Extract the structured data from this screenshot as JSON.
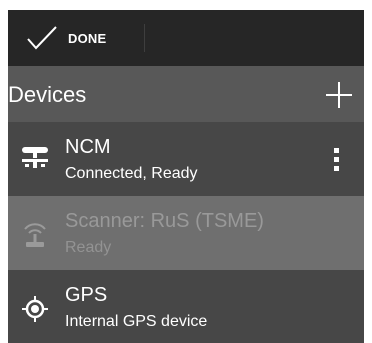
{
  "toolbar": {
    "done_label": "DONE",
    "done_icon": "check-icon"
  },
  "header": {
    "title": "Devices",
    "add_icon": "plus-icon"
  },
  "devices": [
    {
      "name": "NCM",
      "status": "Connected, Ready",
      "icon": "network-node-icon",
      "enabled": true,
      "menu_icon": "more-vert-icon"
    },
    {
      "name": "Scanner: RuS (TSME)",
      "status": "Ready",
      "icon": "antenna-icon",
      "enabled": false
    },
    {
      "name": "GPS",
      "status": "Internal GPS device",
      "icon": "gps-target-icon",
      "enabled": true
    }
  ],
  "colors": {
    "toolbar_bg": "#262626",
    "header_bg": "#585858",
    "row_bg": "#474747",
    "disabled_row_bg": "#6f6f6f",
    "text": "#ffffff",
    "disabled_text": "#999999"
  }
}
